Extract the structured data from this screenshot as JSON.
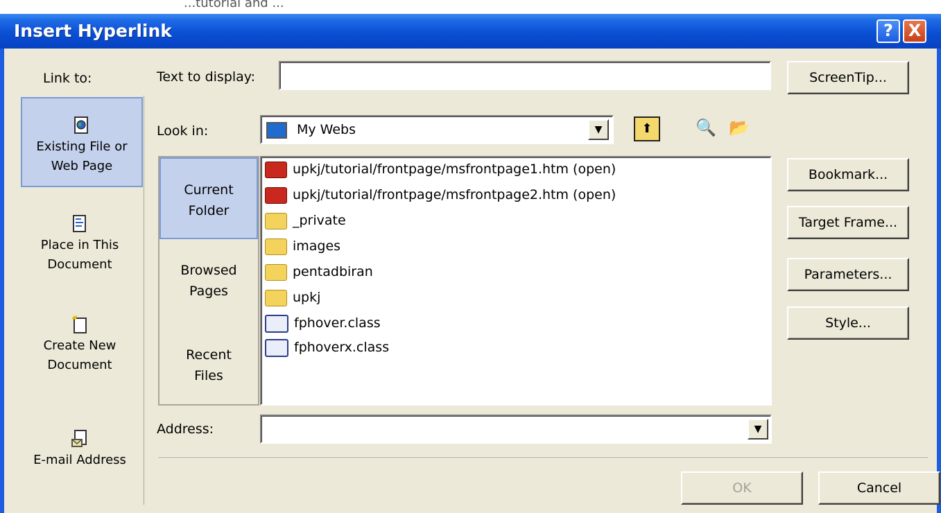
{
  "window": {
    "top_strip": "...tutorial and ...",
    "title": "Insert Hyperlink",
    "help_glyph": "?",
    "close_glyph": "X"
  },
  "link_to": {
    "label": "Link to:",
    "items": [
      {
        "line1": "Existing File or",
        "line2": "Web Page",
        "icon": "web-file-icon"
      },
      {
        "line1": "Place in This",
        "line2": "Document",
        "icon": "document-place-icon"
      },
      {
        "line1": "Create New",
        "line2": "Document",
        "icon": "new-document-icon"
      },
      {
        "line1": "E-mail Address",
        "line2": "",
        "icon": "email-icon"
      }
    ]
  },
  "text_to_display": {
    "label": "Text to display:",
    "value": ""
  },
  "look_in": {
    "label": "Look in:",
    "value": "My Webs"
  },
  "subnav": {
    "current": {
      "line1": "Current",
      "line2": "Folder"
    },
    "browsed": {
      "line1": "Browsed",
      "line2": "Pages"
    },
    "recent": {
      "line1": "Recent",
      "line2": "Files"
    }
  },
  "files": [
    {
      "name": "upkj/tutorial/frontpage/msfrontpage1.htm (open)",
      "icon": "htm-icon"
    },
    {
      "name": "upkj/tutorial/frontpage/msfrontpage2.htm (open)",
      "icon": "htm-icon"
    },
    {
      "name": "_private",
      "icon": "folder-icon"
    },
    {
      "name": "images",
      "icon": "folder-icon"
    },
    {
      "name": "pentadbiran",
      "icon": "folder-icon"
    },
    {
      "name": "upkj",
      "icon": "folder-icon"
    },
    {
      "name": "fphover.class",
      "icon": "class-file-icon"
    },
    {
      "name": "fphoverx.class",
      "icon": "class-file-icon"
    }
  ],
  "address": {
    "label": "Address:",
    "value": ""
  },
  "buttons": {
    "screentip": "ScreenTip...",
    "bookmark": "Bookmark...",
    "target_frame": "Target Frame...",
    "parameters": "Parameters...",
    "style": "Style...",
    "ok": "OK",
    "cancel": "Cancel"
  },
  "colors": {
    "title_bar": "#0a4fd4",
    "selected_item": "#c4d1ec",
    "dialog_bg": "#ece9d8"
  }
}
